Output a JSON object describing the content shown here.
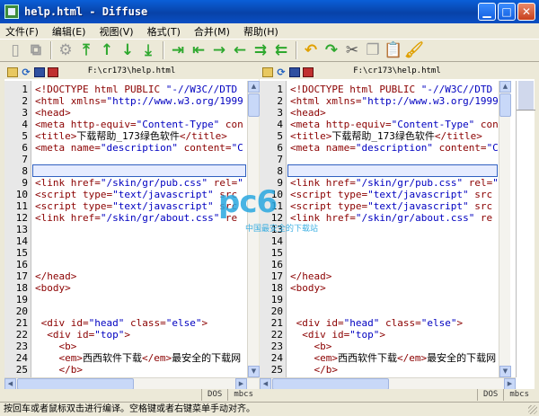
{
  "window": {
    "title": "help.html - Diffuse"
  },
  "menu": [
    "文件(F)",
    "编辑(E)",
    "视图(V)",
    "格式(T)",
    "合并(M)",
    "帮助(H)"
  ],
  "toolbar": [
    {
      "icon": "new-file-icon",
      "color": "gray",
      "glyph": "▯"
    },
    {
      "icon": "copy-file-icon",
      "color": "gray",
      "glyph": "⧉"
    },
    {
      "sep": true
    },
    {
      "icon": "settings-icon",
      "color": "gray",
      "glyph": "⚙"
    },
    {
      "icon": "first-difference-icon",
      "color": "green",
      "glyph": "⤒"
    },
    {
      "icon": "previous-difference-icon",
      "color": "green",
      "glyph": "↑"
    },
    {
      "icon": "next-difference-icon",
      "color": "green",
      "glyph": "↓"
    },
    {
      "icon": "last-difference-icon",
      "color": "green",
      "glyph": "⤓"
    },
    {
      "sep": true
    },
    {
      "icon": "copy-right-icon",
      "color": "green",
      "glyph": "⇥"
    },
    {
      "icon": "copy-left-icon",
      "color": "green",
      "glyph": "⇤"
    },
    {
      "icon": "merge-right-icon",
      "color": "green",
      "glyph": "→"
    },
    {
      "icon": "merge-left-icon",
      "color": "green",
      "glyph": "←"
    },
    {
      "icon": "merge-both-right-icon",
      "color": "green",
      "glyph": "⇉"
    },
    {
      "icon": "merge-both-left-icon",
      "color": "green",
      "glyph": "⇇"
    },
    {
      "sep": true
    },
    {
      "icon": "undo-icon",
      "color": "orange",
      "glyph": "↶"
    },
    {
      "icon": "redo-icon",
      "color": "green",
      "glyph": "↷"
    },
    {
      "icon": "cut-icon",
      "color": "dark",
      "glyph": "✂"
    },
    {
      "icon": "copy-icon",
      "color": "gray",
      "glyph": "❐"
    },
    {
      "icon": "paste-icon",
      "color": "orange",
      "glyph": "📋"
    },
    {
      "icon": "clear-icon",
      "color": "orange",
      "glyph": "🖌"
    }
  ],
  "panes": [
    {
      "path": "F:\\cr173\\help.html",
      "status": [
        "DOS",
        "mbcs"
      ],
      "lines": [
        {
          "n": "1",
          "html": "&lt;!DOCTYPE html PUBLIC <span class='s'>\"-//W3C//DTD</span>"
        },
        {
          "n": "2",
          "html": "&lt;html xmlns=<span class='s'>\"http://www.w3.org/1999</span>"
        },
        {
          "n": "3",
          "html": "&lt;head&gt;"
        },
        {
          "n": "4",
          "html": "&lt;meta http-equiv=<span class='s'>\"Content-Type\"</span> con"
        },
        {
          "n": "5",
          "html": "&lt;title&gt;<span class='t'>下载帮助_173绿色软件</span>&lt;/title&gt;"
        },
        {
          "n": "6",
          "html": "&lt;meta name=<span class='s'>\"description\"</span> content=<span class='s'>\"C</span>"
        },
        {
          "n": "7",
          "html": ""
        },
        {
          "n": "8",
          "html": ""
        },
        {
          "n": "9",
          "html": "&lt;link href=<span class='s'>\"/skin/gr/pub.css\"</span> rel=<span class='s'>\"</span>"
        },
        {
          "n": "10",
          "html": "&lt;script type=<span class='s'>\"text/javascript\"</span> src"
        },
        {
          "n": "11",
          "html": "&lt;script type=<span class='s'>\"text/javascript\"</span> src"
        },
        {
          "n": "12",
          "html": "&lt;link href=<span class='s'>\"/skin/gr/about.css\"</span> re"
        },
        {
          "n": "13",
          "html": ""
        },
        {
          "n": "14",
          "html": ""
        },
        {
          "n": "15",
          "html": ""
        },
        {
          "n": "16",
          "html": ""
        },
        {
          "n": "17",
          "html": "&lt;/head&gt;"
        },
        {
          "n": "18",
          "html": "&lt;body&gt;"
        },
        {
          "n": "19",
          "html": ""
        },
        {
          "n": "20",
          "html": ""
        },
        {
          "n": "21",
          "html": " &lt;div id=<span class='s'>\"head\"</span> class=<span class='s'>\"else\"</span>&gt;"
        },
        {
          "n": "22",
          "html": "  &lt;div id=<span class='s'>\"top\"</span>&gt;"
        },
        {
          "n": "23",
          "html": "    &lt;b&gt;"
        },
        {
          "n": "24",
          "html": "    &lt;em&gt;<span class='t'>西西软件下载</span>&lt;/em&gt;<span class='t'>最安全的下载网</span>"
        },
        {
          "n": "25",
          "html": "    &lt;/b&gt;"
        }
      ]
    },
    {
      "path": "F:\\cr173\\help.html",
      "status": [
        "DOS",
        "mbcs"
      ],
      "lines": [
        {
          "n": "1",
          "html": "&lt;!DOCTYPE html PUBLIC <span class='s'>\"-//W3C//DTD</span>"
        },
        {
          "n": "2",
          "html": "&lt;html xmlns=<span class='s'>\"http://www.w3.org/1999</span>"
        },
        {
          "n": "3",
          "html": "&lt;head&gt;"
        },
        {
          "n": "4",
          "html": "&lt;meta http-equiv=<span class='s'>\"Content-Type\"</span> con"
        },
        {
          "n": "5",
          "html": "&lt;title&gt;<span class='t'>下载帮助_173绿色软件</span>&lt;/title&gt;"
        },
        {
          "n": "6",
          "html": "&lt;meta name=<span class='s'>\"description\"</span> content=<span class='s'>\"C</span>"
        },
        {
          "n": "7",
          "html": ""
        },
        {
          "n": "8",
          "html": ""
        },
        {
          "n": "9",
          "html": "&lt;link href=<span class='s'>\"/skin/gr/pub.css\"</span> rel=<span class='s'>\"</span>"
        },
        {
          "n": "10",
          "html": "&lt;script type=<span class='s'>\"text/javascript\"</span> src"
        },
        {
          "n": "11",
          "html": "&lt;script type=<span class='s'>\"text/javascript\"</span> src"
        },
        {
          "n": "12",
          "html": "&lt;link href=<span class='s'>\"/skin/gr/about.css\"</span> re"
        },
        {
          "n": "13",
          "html": ""
        },
        {
          "n": "14",
          "html": ""
        },
        {
          "n": "15",
          "html": ""
        },
        {
          "n": "16",
          "html": ""
        },
        {
          "n": "17",
          "html": "&lt;/head&gt;"
        },
        {
          "n": "18",
          "html": "&lt;body&gt;"
        },
        {
          "n": "19",
          "html": ""
        },
        {
          "n": "20",
          "html": ""
        },
        {
          "n": "21",
          "html": " &lt;div id=<span class='s'>\"head\"</span> class=<span class='s'>\"else\"</span>&gt;"
        },
        {
          "n": "22",
          "html": "  &lt;div id=<span class='s'>\"top\"</span>&gt;"
        },
        {
          "n": "23",
          "html": "    &lt;b&gt;"
        },
        {
          "n": "24",
          "html": "    &lt;em&gt;<span class='t'>西西软件下载</span>&lt;/em&gt;<span class='t'>最安全的下载网</span>"
        },
        {
          "n": "25",
          "html": "    &lt;/b&gt;"
        }
      ]
    }
  ],
  "selected_line": 8,
  "status_bar": "按回车或者鼠标双击进行编译。空格键或者右键菜单手动对齐。",
  "watermark": {
    "text": "pc6",
    "sub": "中国最安全的下载站"
  },
  "colors": {
    "tag": "#8b0000",
    "string": "#0000c0",
    "title_bar": "#0a5fd8",
    "highlight": "#e6ecff"
  }
}
